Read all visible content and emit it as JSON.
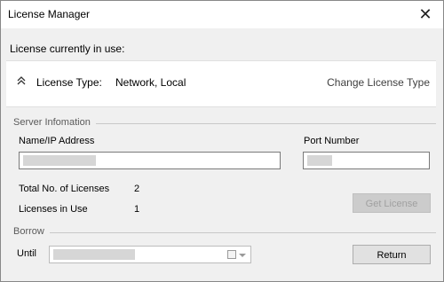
{
  "window": {
    "title": "License Manager",
    "close_glyph": "✕"
  },
  "license": {
    "current_label": "License currently in use:",
    "type_label": "License Type:",
    "type_value": "Network, Local",
    "change_link": "Change License Type",
    "toggle_icon": "double-chevron-up-icon"
  },
  "server": {
    "group_label": "Server Infomation",
    "name_label": "Name/IP Address",
    "name_value": "",
    "port_label": "Port Number",
    "port_value": ""
  },
  "licenses": {
    "total_label": "Total No. of Licenses",
    "total_value": "2",
    "in_use_label": "Licenses in Use",
    "in_use_value": "1",
    "get_button": "Get License"
  },
  "borrow": {
    "group_label": "Borrow",
    "until_label": "Until",
    "until_value": "",
    "return_button": "Return",
    "calendar_icon": "calendar-icon",
    "dropdown_icon": "chevron-down-icon"
  }
}
